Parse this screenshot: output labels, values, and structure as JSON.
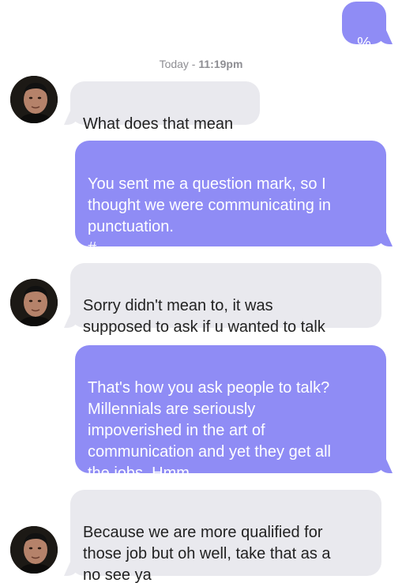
{
  "timestamp": {
    "day": "Today",
    "separator": " - ",
    "time": "11:19pm"
  },
  "messages": [
    {
      "direction": "sent",
      "text": "%"
    },
    {
      "direction": "received",
      "text": "What does that mean"
    },
    {
      "direction": "sent",
      "text": "You sent me a question mark, so I\nthought we were communicating in\npunctuation.\n#"
    },
    {
      "direction": "received",
      "text": "Sorry didn't mean to, it was\nsupposed to ask if u wanted to talk"
    },
    {
      "direction": "sent",
      "text": "That's how you ask people to talk?\nMillennials are seriously\nimpoverished in the art of\ncommunication and yet they get all\nthe jobs. Hmm."
    },
    {
      "direction": "received",
      "text": "Because we are more qualified for\nthose job but oh well, take that as a\nno see ya"
    }
  ],
  "colors": {
    "sent_bubble": "#8f8cf5",
    "received_bubble": "#e9e9ee",
    "timestamp": "#8e8e93"
  }
}
